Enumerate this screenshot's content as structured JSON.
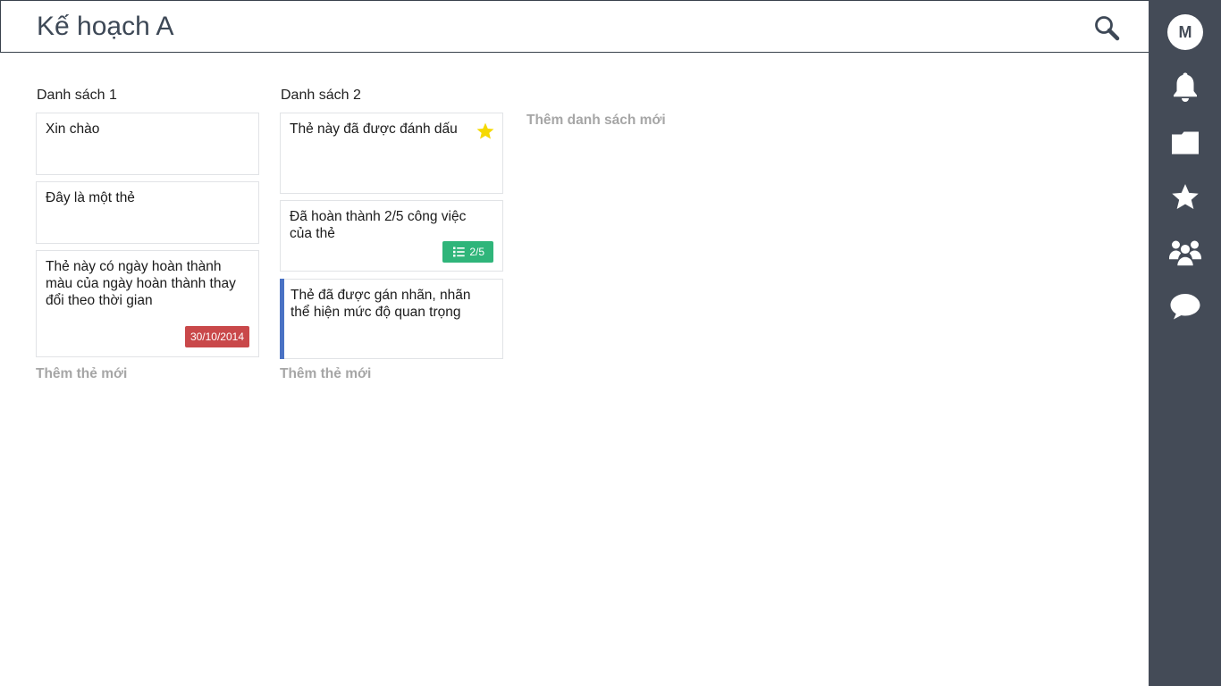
{
  "board": {
    "title": "Kế hoạch A"
  },
  "sidebar": {
    "avatar_initial": "M",
    "items": [
      "bell-icon",
      "folder-icon",
      "star-icon",
      "users-icon",
      "chat-icon"
    ]
  },
  "lists": [
    {
      "title": "Danh sách 1",
      "cards": [
        {
          "text": "Xin chào"
        },
        {
          "text": "Đây là một thẻ"
        },
        {
          "text": "Thẻ này có ngày hoàn thành màu của ngày hoàn thành thay đổi theo thời gian",
          "due_date": "30/10/2014",
          "due_color": "#c9484a"
        }
      ],
      "add_card_label": "Thêm thẻ mới"
    },
    {
      "title": "Danh sách 2",
      "cards": [
        {
          "text": "Thẻ này đã được đánh dấu",
          "starred": true
        },
        {
          "text": "Đã hoàn thành 2/5 công việc của thẻ",
          "checklist": "2/5",
          "checklist_color": "#2fb57a"
        },
        {
          "text": "Thẻ đã được gán nhãn, nhãn thể hiện mức độ quan trọng",
          "label_color": "#4a72c4"
        }
      ],
      "add_card_label": "Thêm thẻ mới"
    }
  ],
  "add_list_label": "Thêm danh sách mới",
  "colors": {
    "sidebar_bg": "#444b57",
    "title_text": "#3d4856",
    "star": "#f5d900"
  }
}
